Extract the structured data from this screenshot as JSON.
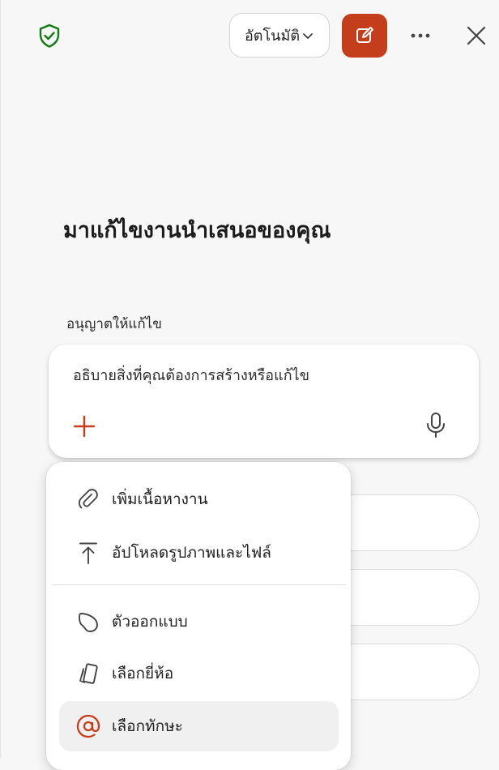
{
  "header": {
    "mode_label": "อัตโนมัติ"
  },
  "main": {
    "heading": "มาแก้ไขงานนำเสนอของคุณ",
    "permission_label": "อนุญาตให้แก้ไข",
    "prompt_placeholder": "อธิบายสิ่งที่คุณต้องการสร้างหรือแก้ไข"
  },
  "menu": {
    "items": [
      {
        "label": "เพิ่มเนื้อหางาน",
        "icon": "paperclip-icon"
      },
      {
        "label": "อัปโหลดรูปภาพและไฟล์",
        "icon": "upload-icon"
      },
      {
        "label": "ตัวออกแบบ",
        "icon": "designer-icon"
      },
      {
        "label": "เลือกยี่ห้อ",
        "icon": "brand-kit-icon"
      },
      {
        "label": "เลือกทักษะ",
        "icon": "at-sign-icon"
      }
    ]
  },
  "colors": {
    "accent": "#c43e1c",
    "shield_green": "#107c10",
    "background": "#f7f7f7"
  }
}
